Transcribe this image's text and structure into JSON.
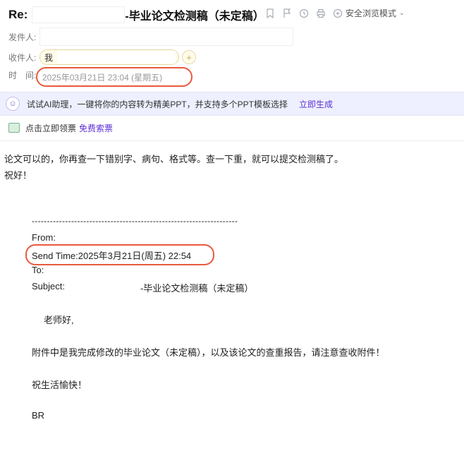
{
  "header": {
    "subject_prefix": "Re:",
    "subject_rest": "-毕业论文检测稿（未定稿）",
    "icons": [
      "bookmark-icon",
      "flag-icon",
      "clock-icon",
      "print-icon"
    ],
    "safe_mode_label": "安全浏览模式",
    "safe_mode_icon": "shield-plus-icon"
  },
  "meta": {
    "sender_label": "发件人:",
    "recipient_label": "收件人:",
    "recipient_name": "我",
    "add_recipient": "+",
    "time_label": "时　间:",
    "time_value": "2025年03月21日 23:04 (星期五)"
  },
  "banner_ai": {
    "text": "试试AI助理，一键将你的内容转为精美PPT，并支持多个PPT模板选择",
    "link": "立即生成"
  },
  "banner_invoice": {
    "text": "点击立即领票",
    "link": "免费索票"
  },
  "body": {
    "line1": "论文可以的，你再查一下错别字、病句、格式等。查一下重，就可以提交检测稿了。",
    "line2": "祝好！"
  },
  "quoted": {
    "separator": "--------------------------------------------------------------------",
    "from": "From:",
    "send_time": "Send Time:2025年3月21日(周五) 22:54",
    "to": "To:",
    "subject_label": "Subject:",
    "subject_value": "-毕业论文检测稿（未定稿）",
    "greeting": "老师好,",
    "paragraph": "附件中是我完成修改的毕业论文（未定稿），以及该论文的查重报告，请注意查收附件！",
    "wish": "祝生活愉快！",
    "signoff": "BR"
  },
  "colors": {
    "highlight_circle": "#e85a3c",
    "link_purple": "#5b2ed6",
    "ai_banner_bg": "#eef0ff"
  }
}
